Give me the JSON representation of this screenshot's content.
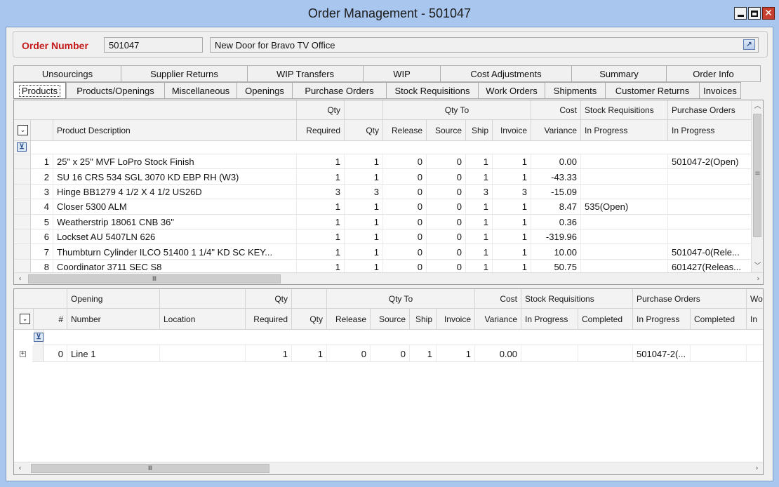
{
  "window": {
    "title": "Order Management - 501047"
  },
  "order": {
    "label": "Order Number",
    "number": "501047",
    "description": "New Door for Bravo TV Office"
  },
  "tabs_back": [
    "Unsourcings",
    "Supplier Returns",
    "WIP Transfers",
    "WIP",
    "Cost Adjustments",
    "Summary",
    "Order Info"
  ],
  "tabs_front": [
    "Products",
    "Products/Openings",
    "Miscellaneous",
    "Openings",
    "Purchase Orders",
    "Stock Requisitions",
    "Work Orders",
    "Shipments",
    "Customer Returns",
    "Invoices"
  ],
  "active_tab": "Products",
  "products": {
    "group_headers": {
      "qty": "Qty",
      "qty_to": "Qty To",
      "cost": "Cost",
      "stock_requisitions": "Stock Requisitions",
      "purchase_orders": "Purchase Orders"
    },
    "columns": {
      "num": "#",
      "desc": "Product Description",
      "required": "Required",
      "qty": "Qty",
      "release": "Release",
      "source": "Source",
      "ship": "Ship",
      "invoice": "Invoice",
      "variance": "Variance",
      "sr_in_progress": "In Progress",
      "po_in_progress": "In Progress"
    },
    "rows": [
      {
        "num": "1",
        "desc": "25\" x 25\" MVF LoPro Stock Finish",
        "required": "1",
        "qty": "1",
        "release": "0",
        "source": "0",
        "ship": "1",
        "invoice": "1",
        "variance": "0.00",
        "sr": "",
        "po": "501047-2(Open)"
      },
      {
        "num": "2",
        "desc": "SU 16 CRS 534 SGL 3070 KD EBP RH (W3)",
        "required": "1",
        "qty": "1",
        "release": "0",
        "source": "0",
        "ship": "1",
        "invoice": "1",
        "variance": "-43.33",
        "sr": "",
        "po": ""
      },
      {
        "num": "3",
        "desc": "Hinge BB1279 4 1/2 X 4 1/2 US26D",
        "required": "3",
        "qty": "3",
        "release": "0",
        "source": "0",
        "ship": "3",
        "invoice": "3",
        "variance": "-15.09",
        "sr": "",
        "po": ""
      },
      {
        "num": "4",
        "desc": "Closer 5300 ALM",
        "required": "1",
        "qty": "1",
        "release": "0",
        "source": "0",
        "ship": "1",
        "invoice": "1",
        "variance": "8.47",
        "sr": "535(Open)",
        "po": ""
      },
      {
        "num": "5",
        "desc": "Weatherstrip 18061 CNB 36\"",
        "required": "1",
        "qty": "1",
        "release": "0",
        "source": "0",
        "ship": "1",
        "invoice": "1",
        "variance": "0.36",
        "sr": "",
        "po": ""
      },
      {
        "num": "6",
        "desc": "Lockset AU 5407LN 626",
        "required": "1",
        "qty": "1",
        "release": "0",
        "source": "0",
        "ship": "1",
        "invoice": "1",
        "variance": "-319.96",
        "sr": "",
        "po": ""
      },
      {
        "num": "7",
        "desc": "Thumbturn Cylinder ILCO 51400 1 1/4\" KD SC KEY...",
        "required": "1",
        "qty": "1",
        "release": "0",
        "source": "0",
        "ship": "1",
        "invoice": "1",
        "variance": "10.00",
        "sr": "",
        "po": "501047-0(Rele..."
      },
      {
        "num": "8",
        "desc": "Coordinator 3711 SEC S8",
        "required": "1",
        "qty": "1",
        "release": "0",
        "source": "0",
        "ship": "1",
        "invoice": "1",
        "variance": "50.75",
        "sr": "",
        "po": "601427(Releas..."
      }
    ]
  },
  "openings": {
    "group_headers": {
      "opening": "Opening",
      "qty": "Qty",
      "qty_to": "Qty To",
      "cost": "Cost",
      "stock_requisitions": "Stock Requisitions",
      "purchase_orders": "Purchase Orders",
      "work_orders": "Wo"
    },
    "columns": {
      "num": "#",
      "number": "Number",
      "location": "Location",
      "required": "Required",
      "qty": "Qty",
      "release": "Release",
      "source": "Source",
      "ship": "Ship",
      "invoice": "Invoice",
      "variance": "Variance",
      "sr_in_progress": "In Progress",
      "sr_completed": "Completed",
      "po_in_progress": "In Progress",
      "po_completed": "Completed",
      "wo_in": "In"
    },
    "rows": [
      {
        "num": "0",
        "number": "Line 1",
        "location": "",
        "required": "1",
        "qty": "1",
        "release": "0",
        "source": "0",
        "ship": "1",
        "invoice": "1",
        "variance": "0.00",
        "sr_ip": "",
        "sr_c": "",
        "po_ip": "501047-2(...",
        "po_c": ""
      }
    ]
  },
  "icons": {
    "minimize": "minimize-icon",
    "maximize": "maximize-icon",
    "close": "close-icon",
    "link": "link-icon",
    "filter": "filter-icon",
    "column_chooser": "chevron-down-icon"
  }
}
